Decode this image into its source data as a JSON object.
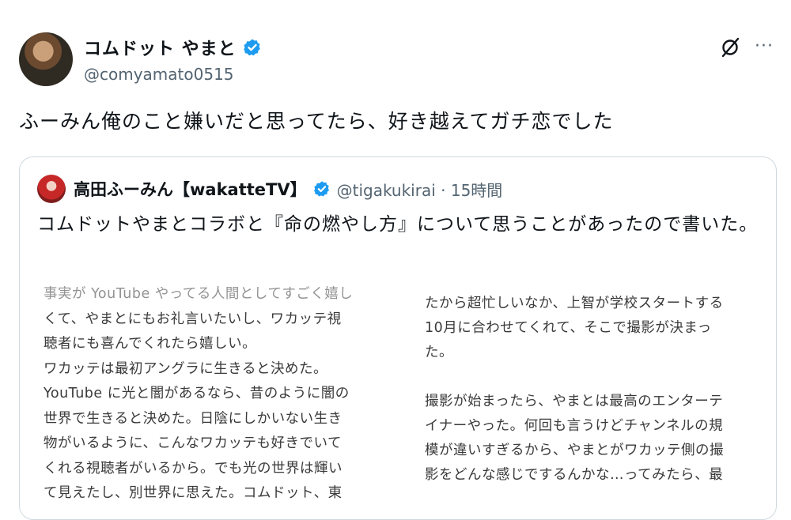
{
  "tweet": {
    "display_name": "コムドット やまと",
    "handle": "@comyamato0515",
    "text": "ふーみん俺のこと嫌いだと思ってたら、好き越えてガチ恋でした",
    "icons": [
      "verified-badge-icon",
      "grok-icon",
      "more-options-icon"
    ]
  },
  "quote": {
    "name": "高田ふーみん【wakatteTV】",
    "handle_time": "@tigakukirai · 15時間",
    "text": "コムドットやまとコラボと『命の燃やし方』について思うことがあったので書いた。",
    "image_left_lines": [
      "事実が YouTube やってる人間としてすごく嬉し",
      "くて、やまとにもお礼言いたいし、ワカッテ視",
      "聴者にも喜んでくれたら嬉しい。",
      "ワカッテは最初アングラに生きると決めた。",
      "YouTube に光と闇があるなら、昔のように闇の",
      "世界で生きると決めた。日陰にしかいない生き",
      "物がいるように、こんなワカッテも好きでいて",
      "くれる視聴者がいるから。でも光の世界は輝い",
      "て見えたし、別世界に思えた。コムドット、東"
    ],
    "image_right_lines_1": [
      "たから超忙しいなか、上智が学校スタートする",
      "10月に合わせてくれて、そこで撮影が決まっ",
      "た。"
    ],
    "image_right_lines_2": [
      "撮影が始まったら、やまとは最高のエンターテ",
      "イナーやった。何回も言うけどチャンネルの規",
      "模が違いすぎるから、やまとがワカッテ側の撮",
      "影をどんな感じでするんかな…ってみたら、最"
    ]
  },
  "colors": {
    "verified": "#1d9bf0",
    "secondary_text": "#536471",
    "border": "#cfd9de"
  }
}
